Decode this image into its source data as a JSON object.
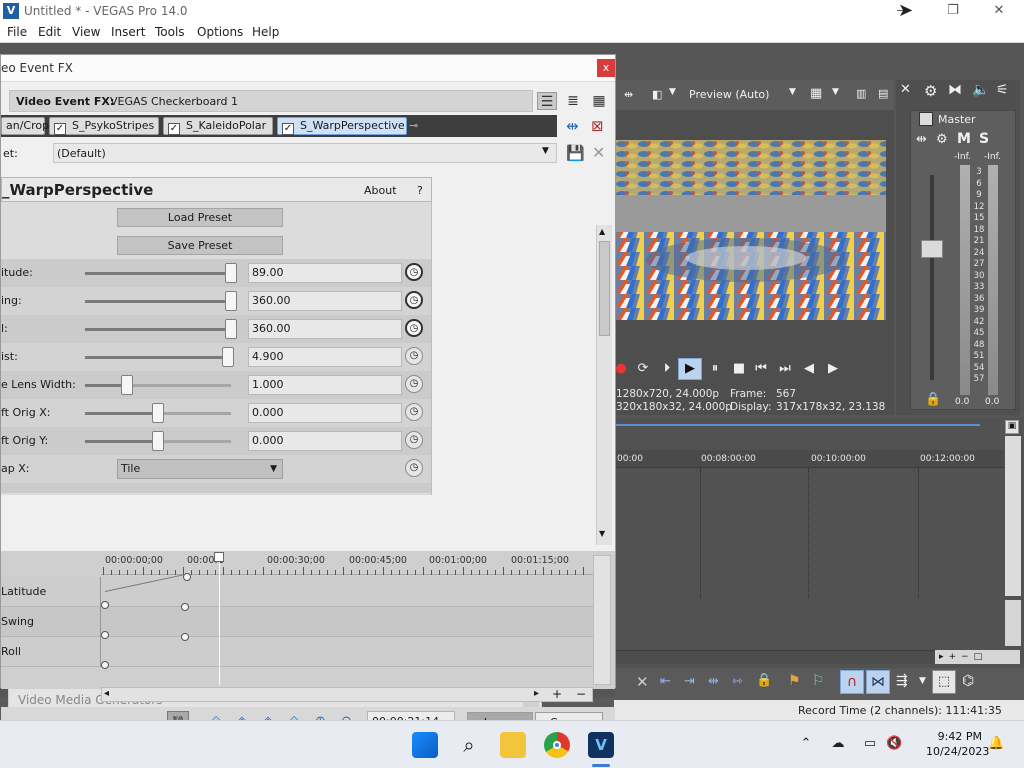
{
  "window": {
    "title": "Untitled * - VEGAS Pro 14.0",
    "minimize": "—",
    "restore": "❐",
    "close": "✕"
  },
  "menu": [
    "File",
    "Edit",
    "View",
    "Insert",
    "Tools",
    "Options",
    "Help"
  ],
  "preview": {
    "mode": "Preview (Auto)",
    "line1_left": "1280x720, 24.000p",
    "line1_right_label": "Frame:",
    "line1_right_val": "567",
    "line2_left": "320x180x32, 24.000p",
    "line2_right_label": "Display:",
    "line2_right_val": "317x178x32, 23.138"
  },
  "mixer": {
    "label": "Master",
    "inf_left": "-Inf.",
    "inf_right": "-Inf.",
    "ticks": [
      "3",
      "6",
      "9",
      "12",
      "15",
      "18",
      "21",
      "24",
      "27",
      "30",
      "33",
      "36",
      "39",
      "42",
      "45",
      "48",
      "51",
      "54",
      "57"
    ],
    "bottom_left": "0.0",
    "bottom_right": "0.0"
  },
  "timeline": {
    "ruler": [
      "00:00",
      "00:08:00:00",
      "00:10:00:00",
      "00:12:00:00"
    ]
  },
  "status": {
    "record_time": "Record Time (2 channels): 111:41:35"
  },
  "media_generators": {
    "title": "Video Media Generators"
  },
  "fx": {
    "title": "eo Event FX",
    "close": "x",
    "header_label": "Video Event FX:",
    "header_value": "VEGAS Checkerboard 1",
    "chain": [
      {
        "label": "an/Crop",
        "checked": false
      },
      {
        "label": "S_PsykoStripes",
        "checked": true
      },
      {
        "label": "S_KaleidoPolar",
        "checked": true
      },
      {
        "label": "S_WarpPerspective",
        "checked": true
      }
    ],
    "preset_label": "et:",
    "preset_value": "(Default)",
    "plugin_name": "_WarpPerspective",
    "about": "About",
    "help": "?",
    "load_preset": "Load Preset",
    "save_preset": "Save Preset",
    "params": [
      {
        "label": "itude:",
        "value": "89.00",
        "level": 1.0
      },
      {
        "label": "ing:",
        "value": "360.00",
        "level": 1.0
      },
      {
        "label": "l:",
        "value": "360.00",
        "level": 1.0
      },
      {
        "label": "ist:",
        "value": "4.900",
        "level": 0.98
      },
      {
        "label": "e Lens Width:",
        "value": "1.000",
        "level": 0.29
      },
      {
        "label": "ft Orig X:",
        "value": "0.000",
        "level": 0.5
      },
      {
        "label": "ft Orig Y:",
        "value": "0.000",
        "level": 0.5
      }
    ],
    "wrap_label": "ap X:",
    "wrap_value": "Tile",
    "kf_ruler": [
      "00:00:00;00",
      "00:00:1",
      "00:00:30;00",
      "00:00:45;00",
      "00:01:00;00",
      "00:01:15;00"
    ],
    "kf_tracks": [
      "Latitude",
      "Swing",
      "Roll"
    ],
    "timecode": "00:00:21:14",
    "tab_lanes": "Lanes",
    "tab_curves": "Curves"
  },
  "taskbar": {
    "time": "9:42 PM",
    "date": "10/24/2023"
  }
}
